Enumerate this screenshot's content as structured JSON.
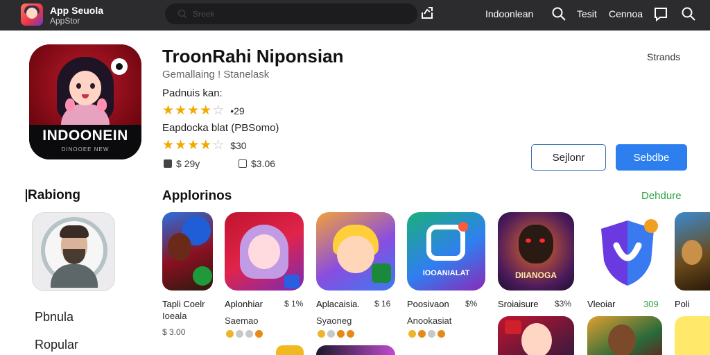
{
  "topbar": {
    "brand_title": "App Seuola",
    "brand_sub": "AppStor",
    "search_placeholder": "Sreek",
    "links": [
      "Indoonlean",
      "Tesit",
      "Cennoa"
    ]
  },
  "hero": {
    "title": "TroonRahi Niponsian",
    "subtitle": "Gemallaing ! Stanelask",
    "icon_word": "INDOONEIN",
    "icon_tagline": "DINOOEE NEW",
    "section1_label": "Padnuis kan:",
    "rating1": {
      "stars": "★★★★",
      "half": "☆",
      "value": "•29"
    },
    "section2_label": "Eapdocka blat (PBSomo)",
    "rating2": {
      "stars": "★★★★",
      "half": "☆",
      "value": "$30"
    },
    "meta1": "$ 29y",
    "meta2": "$3.06",
    "settings_link": "Strands",
    "button_outline": "Sejlonr",
    "button_solid": "Sebdbe"
  },
  "sidebar": {
    "heading": "Rabiong",
    "items": [
      "Pbnula",
      "Ropular"
    ]
  },
  "apps": {
    "heading": "Applorinos",
    "see_more": "Dehdure",
    "tiles": [
      {
        "name": "Tapli Coelr",
        "price": "",
        "sub": "Ioeala",
        "small": "$ 3.00",
        "icon_text": ""
      },
      {
        "name": "Aplonhiar",
        "price": "$ 1%",
        "sub": "Saemao",
        "small": "",
        "icon_text": ""
      },
      {
        "name": "Aplacaisia.",
        "price": "$ 16",
        "sub": "Syaoneg",
        "small": "",
        "icon_text": ""
      },
      {
        "name": "Poosivaon",
        "price": "$%",
        "sub": "Anookasiat",
        "small": "",
        "icon_text": "IOOANIALAT"
      },
      {
        "name": "Sroiaisure",
        "price": "$3%",
        "sub": "",
        "small": "",
        "icon_text": "DIIANOGA"
      },
      {
        "name": "Vleoiar",
        "price": "309",
        "sub": "",
        "small": "",
        "icon_text": ""
      },
      {
        "name": "Poli",
        "price": "",
        "sub": "",
        "small": "",
        "icon_text": ""
      }
    ]
  },
  "colors": {
    "topbar": "#2c2c2e",
    "accent_blue": "#2d7ff0",
    "outline_blue": "#2f6fb5",
    "link_green": "#2ca243",
    "star_gold": "#f2a900"
  },
  "icons": [
    "app-store-logo-icon",
    "search-icon",
    "share-icon",
    "chat-icon",
    "star-icon",
    "download-icon",
    "size-icon"
  ]
}
